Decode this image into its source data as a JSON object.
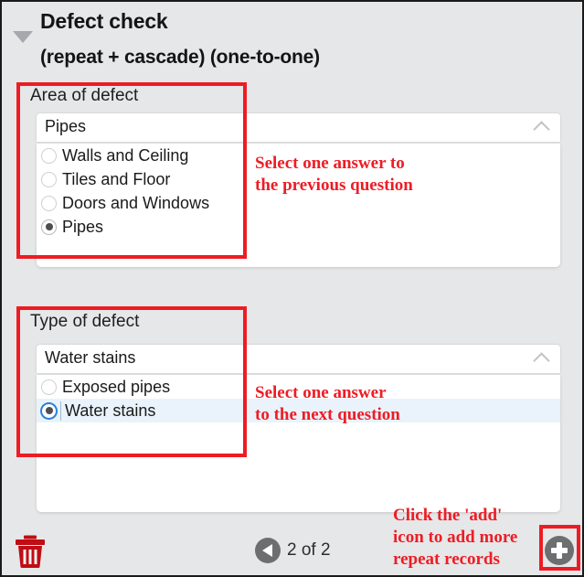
{
  "header": {
    "title_line1": "Defect check",
    "title_line2": "(repeat + cascade) (one-to-one)",
    "collapse_icon": "triangle-down-icon"
  },
  "questions": [
    {
      "label": "Area of defect",
      "selected_value": "Pipes",
      "caret_icon": "chevron-up-icon",
      "options": [
        {
          "label": "Walls and Ceiling",
          "checked": false,
          "focused": false
        },
        {
          "label": "Tiles and Floor",
          "checked": false,
          "focused": false
        },
        {
          "label": "Doors and Windows",
          "checked": false,
          "focused": false
        },
        {
          "label": "Pipes",
          "checked": true,
          "focused": false
        }
      ],
      "annotation": "Select one answer to\nthe previous question"
    },
    {
      "label": "Type of defect",
      "selected_value": "Water stains",
      "caret_icon": "chevron-up-icon",
      "options": [
        {
          "label": "Exposed pipes",
          "checked": false,
          "focused": false
        },
        {
          "label": "Water stains",
          "checked": true,
          "focused": true
        }
      ],
      "annotation": "Select one answer\nto the next question"
    }
  ],
  "footer": {
    "delete_icon": "trash-icon",
    "prev_icon": "triangle-left-icon",
    "pager_text": "2 of 2",
    "add_icon": "plus-icon",
    "add_annotation": "Click the 'add'\nicon to add more\nrepeat records"
  },
  "colors": {
    "accent_red": "#ed1c24",
    "annotation_red": "#ee1c25",
    "panel_background": "#e6e7e8",
    "field_background": "#ffffff",
    "selected_row": "#eaf3fb",
    "icon_gray": "#6d6e70",
    "trash_red": "#c00d14"
  }
}
